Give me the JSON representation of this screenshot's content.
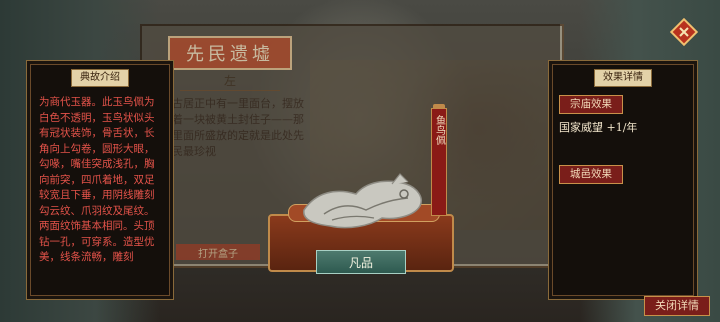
{
  "background": {
    "scroll_title": "先民遗墟",
    "scroll_subtitle": "左",
    "scroll_text": "古居正中有一里面台，摆放着一块被黄土封住子——那里面所盛放的定就是此处先民最珍视",
    "scroll_button": "打开盒子"
  },
  "left_panel": {
    "header": "典故介绍",
    "description": "为商代玉器。此玉鸟佩为白色不透明，玉鸟状似头有冠状装饰，骨舌状，长角向上勾卷，圆形大眼，勾喙，嘴佳突成浅孔，胸向前突，四爪着地，双足较宽且下垂，用阴线雕刻勾云纹、爪羽纹及尾纹。两面纹饰基本相同。头顶钻一孔，可穿系。造型优美，线条流畅，雕刻"
  },
  "right_panel": {
    "header": "效果详情",
    "temple_button": "宗庙效果",
    "temple_effect": "国家威望 +1/年",
    "city_button": "城邑效果"
  },
  "artifact": {
    "name_banner": "鱼鸟佩",
    "rank": "凡品"
  },
  "close_detail_button": "关闭详情",
  "colors": {
    "panel_bg": "#140f0b",
    "border_gold": "#8a6a3a",
    "description_red": "#e4534a",
    "button_red": "#7a1e1a",
    "rank_teal": "#3e6a5e"
  },
  "icons": {
    "close": "close-x-diamond-icon",
    "artifact": "jade-bird-pendant"
  }
}
